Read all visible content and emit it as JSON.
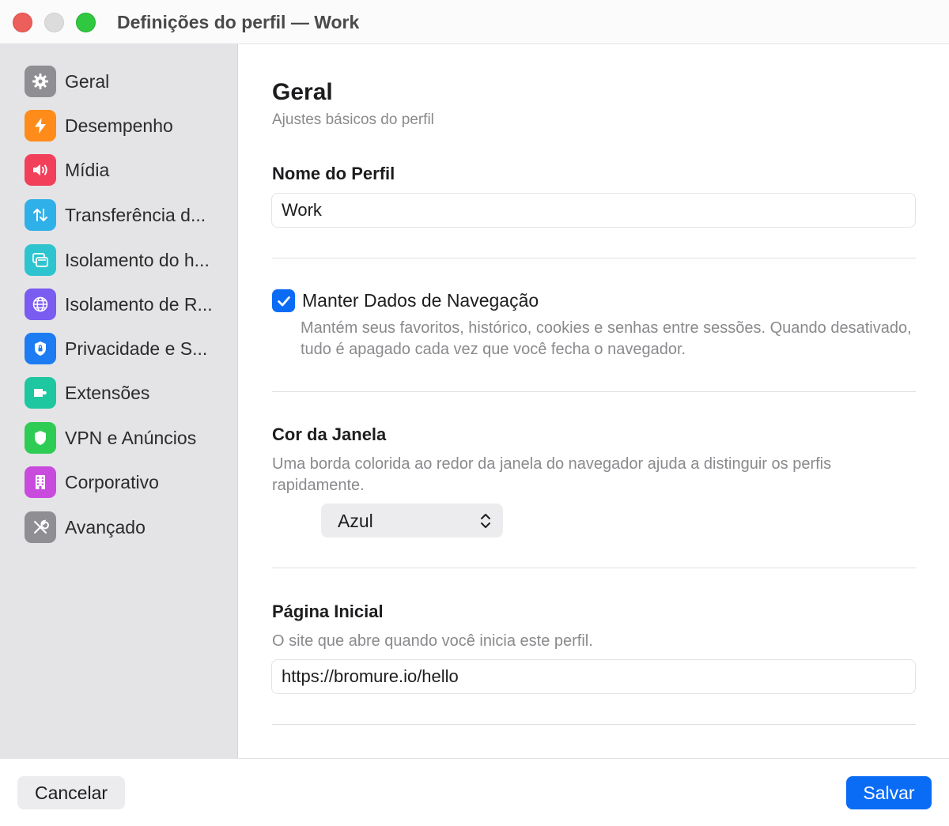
{
  "window": {
    "title": "Definições do perfil — Work"
  },
  "sidebar": {
    "items": [
      {
        "label": "Geral",
        "icon": "gear-icon",
        "color": "#8e8e93"
      },
      {
        "label": "Desempenho",
        "icon": "bolt-icon",
        "color": "#ff8c1a"
      },
      {
        "label": "Mídia",
        "icon": "speaker-icon",
        "color": "#f23f5a"
      },
      {
        "label": "Transferência d...",
        "icon": "transfer-arrows-icon",
        "color": "#30b0e8"
      },
      {
        "label": "Isolamento do h...",
        "icon": "window-icon",
        "color": "#2ec4cf"
      },
      {
        "label": "Isolamento de R...",
        "icon": "globe-icon",
        "color": "#7a5cf0"
      },
      {
        "label": "Privacidade e S...",
        "icon": "lock-shield-icon",
        "color": "#1e7cf2"
      },
      {
        "label": "Extensões",
        "icon": "extension-icon",
        "color": "#1fc7a0"
      },
      {
        "label": "VPN e Anúncios",
        "icon": "shield-icon",
        "color": "#2fcc55"
      },
      {
        "label": "Corporativo",
        "icon": "building-icon",
        "color": "#c94bde"
      },
      {
        "label": "Avançado",
        "icon": "tools-icon",
        "color": "#8e8e93"
      }
    ]
  },
  "main": {
    "title": "Geral",
    "subtitle": "Ajustes básicos do perfil",
    "profile_name": {
      "label": "Nome do Perfil",
      "value": "Work"
    },
    "keep_data": {
      "label": "Manter Dados de Navegação",
      "checked": true,
      "description": "Mantém seus favoritos, histórico, cookies e senhas entre sessões. Quando desativado, tudo é apagado cada vez que você fecha o navegador."
    },
    "window_color": {
      "label": "Cor da Janela",
      "description": "Uma borda colorida ao redor da janela do navegador ajuda a distinguir os perfis rapidamente.",
      "selected": "Azul"
    },
    "home_page": {
      "label": "Página Inicial",
      "description": "O site que abre quando você inicia este perfil.",
      "value": "https://bromure.io/hello"
    }
  },
  "footer": {
    "cancel_label": "Cancelar",
    "save_label": "Salvar"
  },
  "colors": {
    "accent": "#0a6cf5",
    "sidebar_bg": "#e4e4e6"
  }
}
